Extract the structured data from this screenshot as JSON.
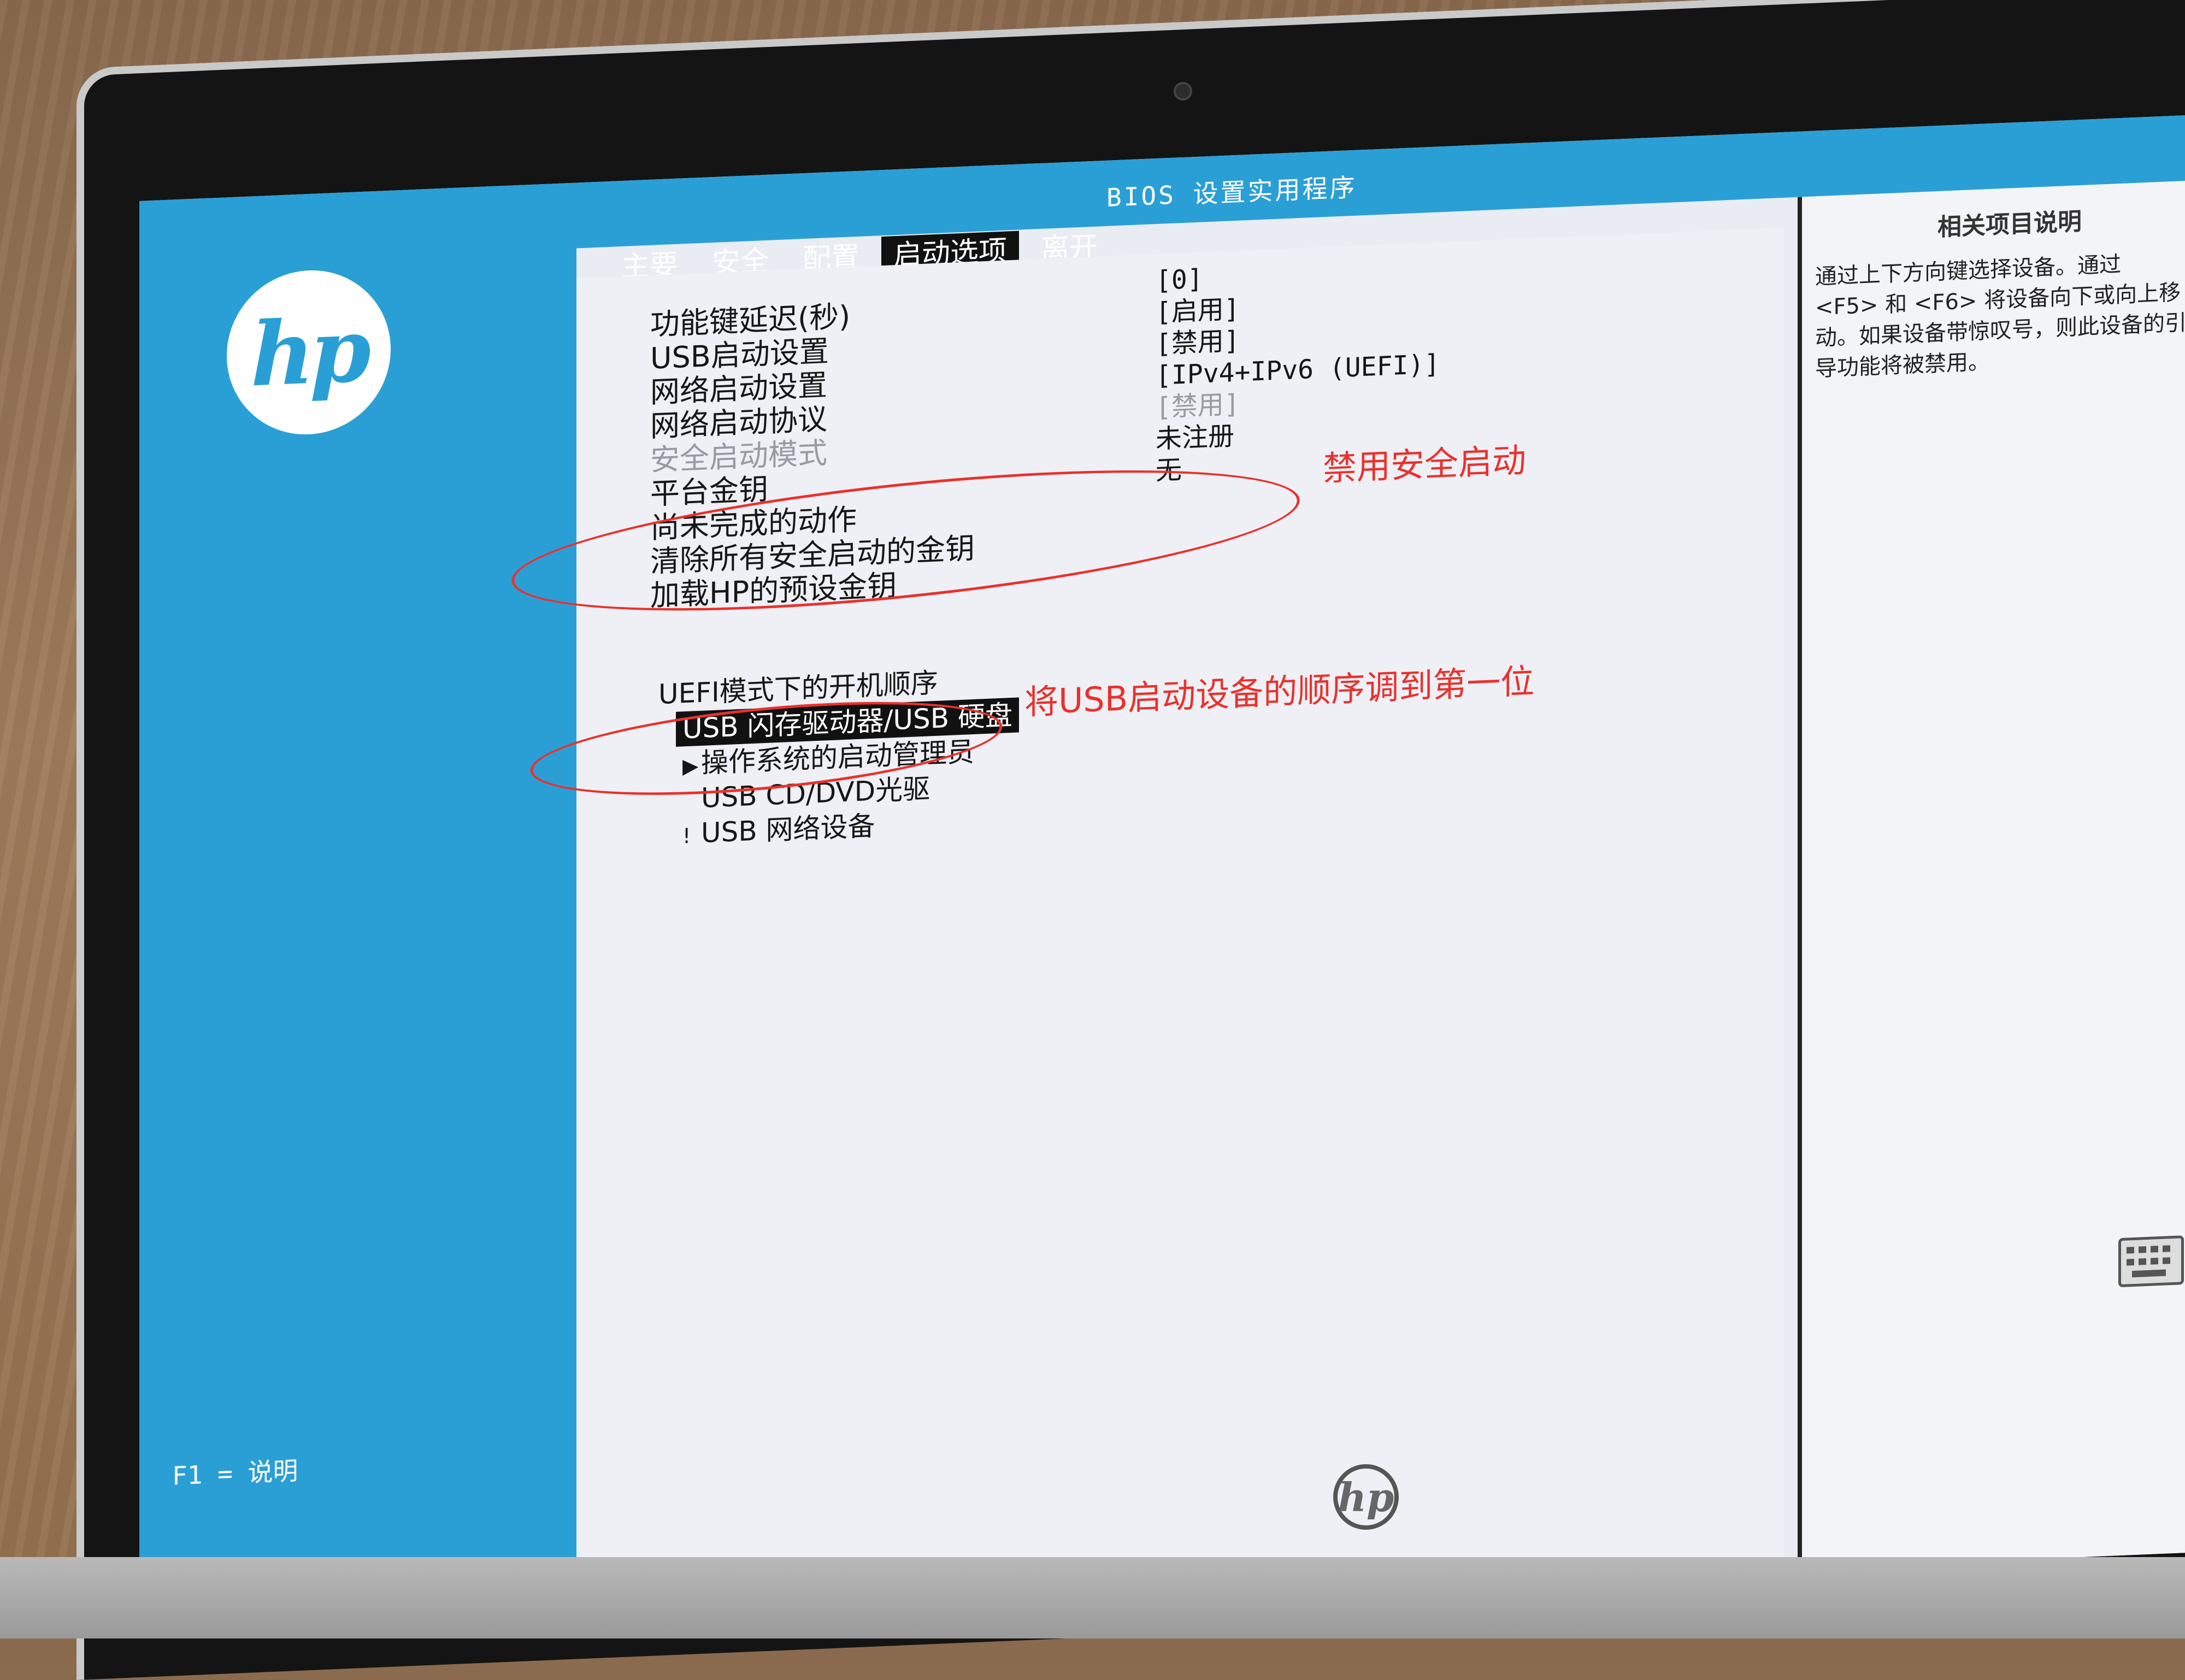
{
  "window": {
    "title": "BIOS 设置实用程序"
  },
  "menu": {
    "tabs": [
      {
        "label": "主要",
        "active": false
      },
      {
        "label": "安全",
        "active": false
      },
      {
        "label": "配置",
        "active": false
      },
      {
        "label": "启动选项",
        "active": true
      },
      {
        "label": "离开",
        "active": false
      }
    ]
  },
  "settings": [
    {
      "label": "功能键延迟(秒)",
      "value": "[0]",
      "disabled": false
    },
    {
      "label": "USB启动设置",
      "value": "[启用]",
      "disabled": false
    },
    {
      "label": "网络启动设置",
      "value": "[禁用]",
      "disabled": false
    },
    {
      "label": "网络启动协议",
      "value": "[IPv4+IPv6 (UEFI)]",
      "disabled": false
    },
    {
      "label": "安全启动模式",
      "value": "[禁用]",
      "disabled": true
    },
    {
      "label": "平台金钥",
      "value": "未注册",
      "disabled": false
    },
    {
      "label": "尚未完成的动作",
      "value": "无",
      "disabled": false
    },
    {
      "label": "清除所有安全启动的金钥",
      "value": "",
      "disabled": false
    },
    {
      "label": "加载HP的预设金钥",
      "value": "",
      "disabled": false
    }
  ],
  "boot_order": {
    "heading": "UEFI模式下的开机顺序",
    "items": [
      {
        "label": "USB 闪存驱动器/USB 硬盘",
        "marker": "",
        "selected": true
      },
      {
        "label": "操作系统的启动管理员",
        "marker": "▶",
        "selected": false
      },
      {
        "label": "USB CD/DVD光驱",
        "marker": "",
        "selected": false
      },
      {
        "label": "USB 网络设备",
        "marker": "!",
        "selected": false
      }
    ]
  },
  "help_panel": {
    "title": "相关项目说明",
    "text": "通过上下方向键选择设备。通过 <F5> 和 <F6> 将设备向下或向上移动。如果设备带惊叹号，则此设备的引导功能将被禁用。"
  },
  "footer": {
    "f1_help": "F1 = 说明"
  },
  "annotations": {
    "secure_boot": "禁用安全启动",
    "usb_first": "将USB启动设备的顺序调到第一位",
    "color": "#e8322c"
  },
  "brand": {
    "logo": "hp",
    "color": "#2a9fd6"
  }
}
